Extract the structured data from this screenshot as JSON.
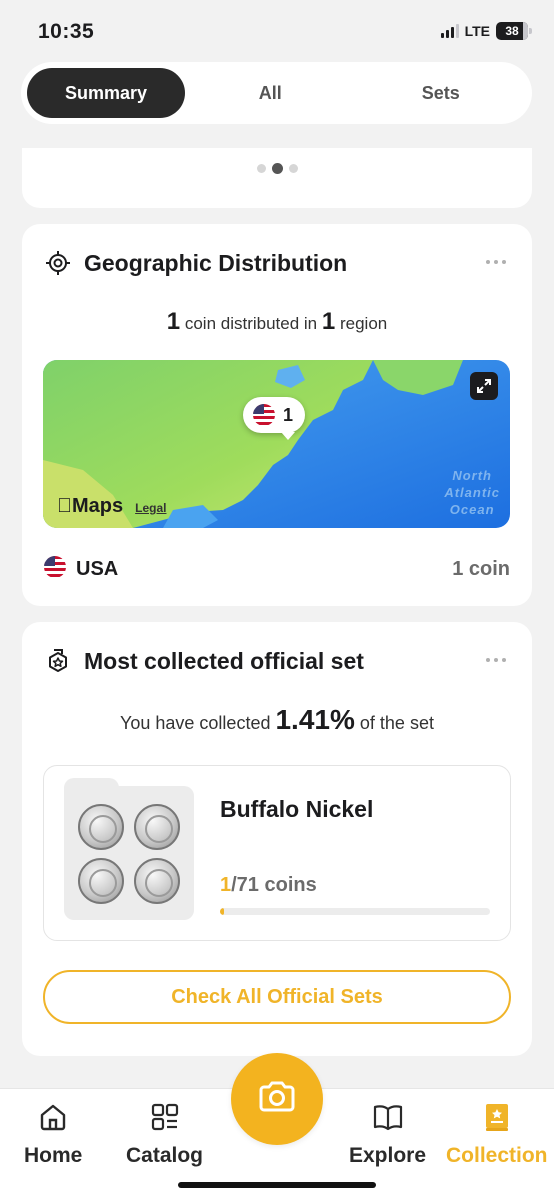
{
  "status_bar": {
    "time": "10:35",
    "network": "LTE",
    "battery": "38"
  },
  "tabs": [
    {
      "label": "Summary",
      "active": true
    },
    {
      "label": "All",
      "active": false
    },
    {
      "label": "Sets",
      "active": false
    }
  ],
  "carousel": {
    "pages": 3,
    "active_index": 1
  },
  "geo": {
    "title": "Geographic Distribution",
    "summary": {
      "coin_count": "1",
      "coin_text": "coin distributed in",
      "region_count": "1",
      "region_text": "region"
    },
    "map": {
      "pin_count": "1",
      "brand": "Maps",
      "legal": "Legal",
      "ocean_lines": [
        "North",
        "Atlantic",
        "Ocean"
      ]
    },
    "region": {
      "name": "USA",
      "count": "1 coin"
    }
  },
  "official_set": {
    "title": "Most collected official set",
    "summary_prefix": "You have collected",
    "percent": "1.41%",
    "summary_suffix": "of the set",
    "set_name": "Buffalo Nickel",
    "owned": "1",
    "total_text": "/71 coins",
    "progress_fraction": 0.0141,
    "button_label": "Check All Official Sets"
  },
  "nav": {
    "items": [
      {
        "label": "Home",
        "icon": "home-icon"
      },
      {
        "label": "Catalog",
        "icon": "catalog-icon"
      },
      {
        "label": "Explore",
        "icon": "book-icon"
      },
      {
        "label": "Collection",
        "icon": "collection-icon",
        "active": true
      }
    ]
  },
  "colors": {
    "accent": "#f0b429",
    "dark": "#2a2a2a",
    "background": "#f2f2f2"
  }
}
